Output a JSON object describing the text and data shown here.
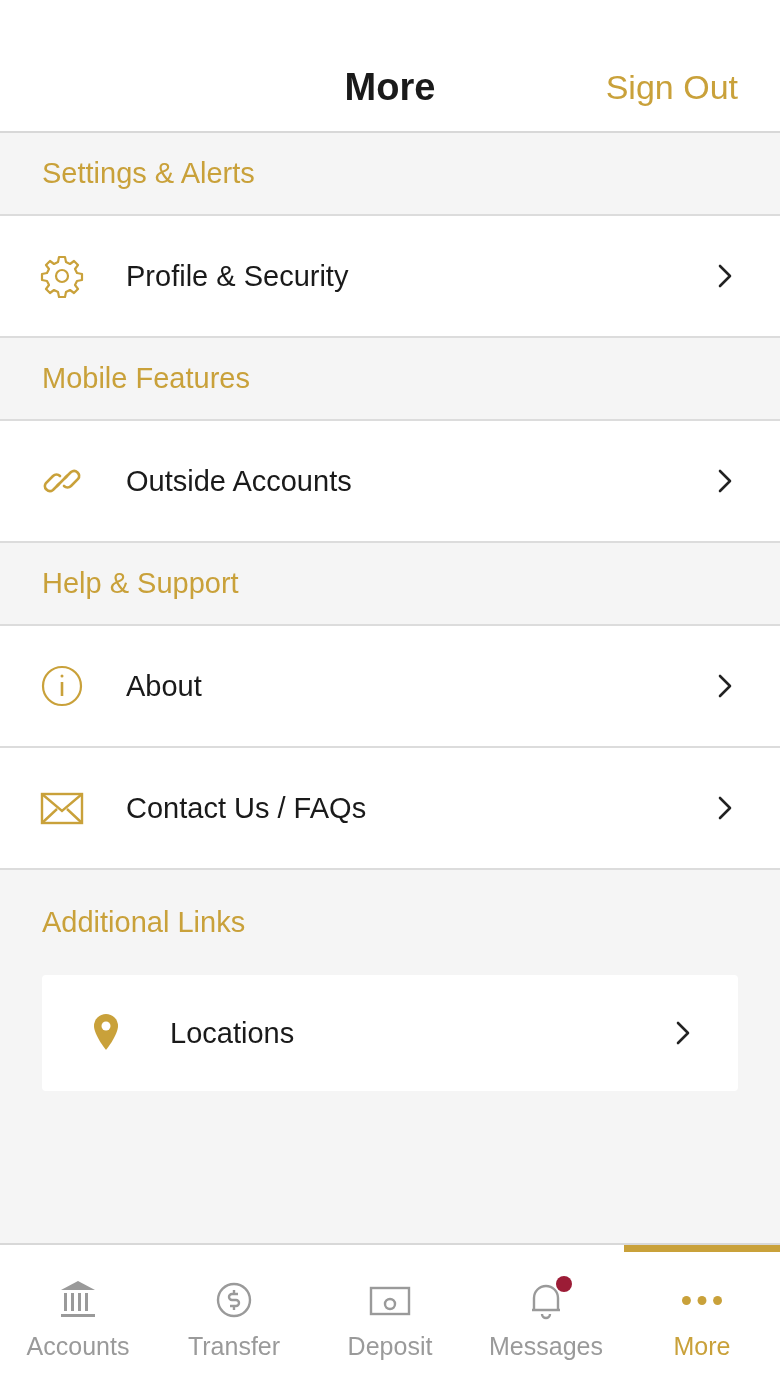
{
  "header": {
    "title": "More",
    "action": "Sign Out"
  },
  "sections": [
    {
      "title": "Settings & Alerts",
      "kind": "list",
      "items": [
        {
          "label": "Profile & Security",
          "kind": "gear"
        }
      ]
    },
    {
      "title": "Mobile Features",
      "kind": "list",
      "items": [
        {
          "label": "Outside Accounts",
          "kind": "link"
        }
      ]
    },
    {
      "title": "Help & Support",
      "kind": "list",
      "items": [
        {
          "label": "About",
          "kind": "info"
        },
        {
          "label": "Contact Us / FAQs",
          "kind": "mail"
        }
      ]
    },
    {
      "title": "Additional Links",
      "kind": "card",
      "items": [
        {
          "label": "Locations",
          "kind": "pin"
        }
      ]
    }
  ],
  "nav": [
    {
      "label": "Accounts",
      "kind": "bank",
      "selected": false,
      "badge": false
    },
    {
      "label": "Transfer",
      "kind": "transfer",
      "selected": false,
      "badge": false
    },
    {
      "label": "Deposit",
      "kind": "deposit",
      "selected": false,
      "badge": false
    },
    {
      "label": "Messages",
      "kind": "bell",
      "selected": false,
      "badge": true
    },
    {
      "label": "More",
      "kind": "dots",
      "selected": true,
      "badge": false
    }
  ]
}
